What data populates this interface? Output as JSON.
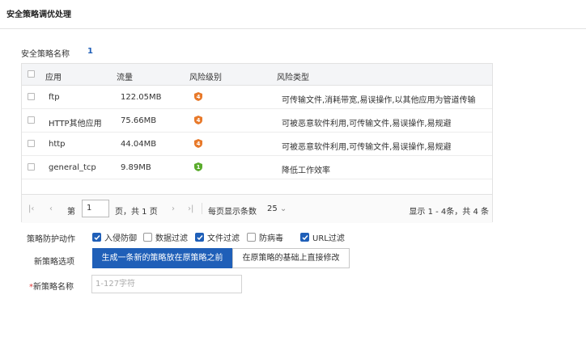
{
  "page_title": "安全策略调优处理",
  "policy": {
    "label": "安全策略名称",
    "value": "1"
  },
  "table": {
    "headers": [
      "应用",
      "流量",
      "风险级别",
      "风险类型"
    ],
    "rows": [
      {
        "app": "ftp",
        "traffic": "122.05MB",
        "level": "4",
        "level_color": "#e8792a",
        "risk": "可传输文件,消耗带宽,易误操作,以其他应用为管道传输"
      },
      {
        "app": "HTTP其他应用",
        "traffic": "75.66MB",
        "level": "4",
        "level_color": "#e8792a",
        "risk": "可被恶意软件利用,可传输文件,易误操作,易规避"
      },
      {
        "app": "http",
        "traffic": "44.04MB",
        "level": "4",
        "level_color": "#e8792a",
        "risk": "可被恶意软件利用,可传输文件,易误操作,易规避"
      },
      {
        "app": "general_tcp",
        "traffic": "9.89MB",
        "level": "1",
        "level_color": "#5aab2c",
        "risk": "降低工作效率"
      }
    ]
  },
  "pager": {
    "prefix": "第",
    "page": "1",
    "suffix": "页，共 1 页",
    "per_page_label": "每页显示条数",
    "per_page": "25",
    "summary": "显示 1 - 4条，共 4 条"
  },
  "actions": {
    "label": "策略防护动作",
    "items": [
      {
        "label": "入侵防御",
        "checked": true
      },
      {
        "label": "数据过滤",
        "checked": false
      },
      {
        "label": "文件过滤",
        "checked": true
      },
      {
        "label": "防病毒",
        "checked": false
      },
      {
        "label": "URL过滤",
        "checked": true
      }
    ]
  },
  "new_policy_option": {
    "label": "新策略选项",
    "option_a": "生成一条新的策略放在原策略之前",
    "option_b": "在原策略的基础上直接修改"
  },
  "new_policy_name": {
    "required_mark": "*",
    "label": "新策略名称",
    "placeholder": "1-127字符"
  },
  "colors": {
    "accent": "#1f5fb8",
    "risk_high": "#e8792a",
    "risk_low": "#5aab2c"
  }
}
